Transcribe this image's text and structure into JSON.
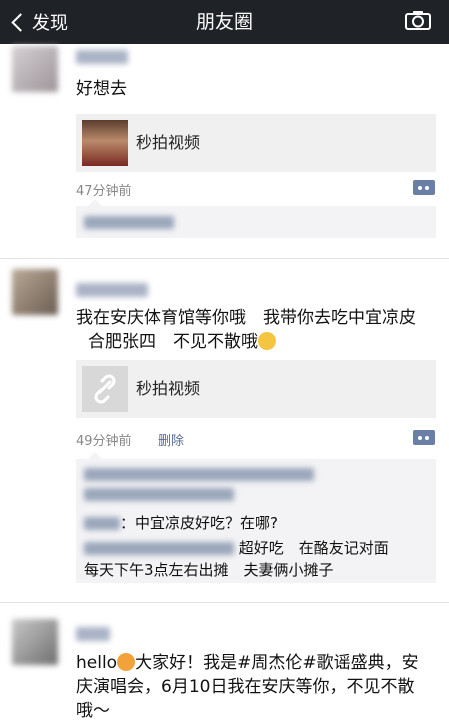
{
  "navbar": {
    "back_label": "发现",
    "title": "朋友圈"
  },
  "posts": [
    {
      "text": "好想去",
      "card_title": "秒拍视频",
      "time": "47分钟前"
    },
    {
      "text_line1": "我在安庆体育馆等你哦　我带你去吃中宜凉皮",
      "text_line2": "合肥张四　不见不散哦",
      "card_title": "秒拍视频",
      "time": "49分钟前",
      "delete_label": "删除",
      "comments": [
        {
          "text": "：中宜凉皮好吃？在哪?"
        },
        {
          "text": "超好吃　在酪友记对面"
        },
        {
          "text": "每天下午3点左右出摊　夫妻俩小摊子"
        }
      ]
    },
    {
      "text_line1_prefix": "hello",
      "text_line1_rest": "大家好！我是#周杰伦#歌谣盛典，安",
      "text_line2": "庆演唱会，6月10日我在安庆等你，不见不散",
      "text_line3": "哦～"
    }
  ]
}
